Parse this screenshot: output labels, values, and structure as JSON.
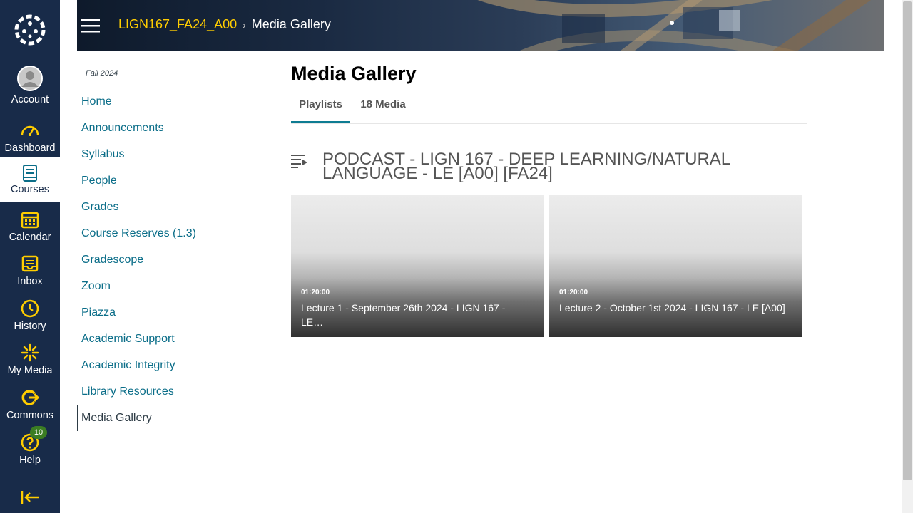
{
  "global_nav": {
    "items": [
      {
        "label": "Account",
        "icon": "avatar"
      },
      {
        "label": "Dashboard",
        "icon": "dashboard-icon"
      },
      {
        "label": "Courses",
        "icon": "courses-icon"
      },
      {
        "label": "Calendar",
        "icon": "calendar-icon"
      },
      {
        "label": "Inbox",
        "icon": "inbox-icon"
      },
      {
        "label": "History",
        "icon": "history-icon"
      },
      {
        "label": "My Media",
        "icon": "my-media-icon"
      },
      {
        "label": "Commons",
        "icon": "commons-icon"
      },
      {
        "label": "Help",
        "icon": "help-icon"
      }
    ],
    "help_badge": "10",
    "accent": "#ffcd00",
    "bg": "#182b49"
  },
  "header": {
    "course": "LIGN167_FA24_A00",
    "current": "Media Gallery",
    "separator": "›"
  },
  "course_nav": {
    "term": "Fall 2024",
    "items": [
      {
        "label": "Home"
      },
      {
        "label": "Announcements"
      },
      {
        "label": "Syllabus"
      },
      {
        "label": "People"
      },
      {
        "label": "Grades"
      },
      {
        "label": "Course Reserves (1.3)"
      },
      {
        "label": "Gradescope"
      },
      {
        "label": "Zoom"
      },
      {
        "label": "Piazza"
      },
      {
        "label": "Academic Support"
      },
      {
        "label": "Academic Integrity"
      },
      {
        "label": "Library Resources"
      },
      {
        "label": "Media Gallery"
      }
    ],
    "link_color": "#0a6d88"
  },
  "main": {
    "title": "Media Gallery",
    "tabs": [
      {
        "label": "Playlists",
        "active": true
      },
      {
        "label": "18 Media",
        "active": false
      }
    ],
    "playlist": {
      "title": "PODCAST - LIGN 167 - DEEP LEARNING/NATURAL LANGUAGE - LE [A00] [FA24]",
      "entries": [
        {
          "duration": "01:20:00",
          "name": "Lecture 1 - September 26th 2024 - LIGN 167 - LE…"
        },
        {
          "duration": "01:20:00",
          "name": "Lecture 2 - October 1st 2024 - LIGN 167 - LE [A00]"
        }
      ]
    }
  }
}
